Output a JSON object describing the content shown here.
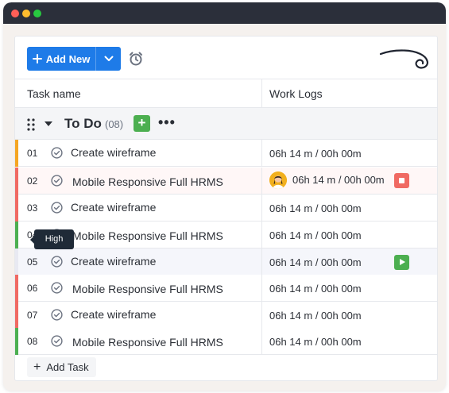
{
  "window": {
    "controls": [
      "close",
      "minimize",
      "maximize"
    ]
  },
  "toolbar": {
    "add_new_label": "Add New",
    "add_icon": "plus-icon",
    "dropdown_icon": "chevron-down-icon",
    "alarm_icon": "alarm-clock-icon",
    "logo_icon": "swirl-logo"
  },
  "table": {
    "columns": [
      "Task name",
      "Work Logs"
    ]
  },
  "group": {
    "title": "To Do",
    "count": "(08)",
    "add_label": "+",
    "more_label": "•••",
    "color": "#4caf50"
  },
  "tasks": [
    {
      "num": "01",
      "name": "Create wireframe",
      "log": "06h 14 m / 00h 00m",
      "priority_color": "#f5a623"
    },
    {
      "num": "02",
      "name": "Mobile Responsive Full HRMS",
      "log": "06h 14 m / 00h 00m",
      "priority_color": "#f06a63",
      "timer": "stop"
    },
    {
      "num": "03",
      "name": "Create wireframe",
      "log": "06h 14 m / 00h 00m",
      "priority_color": "#f06a63"
    },
    {
      "num": "04",
      "name": "Mobile Responsive Full HRMS",
      "log": "06h 14 m / 00h 00m",
      "priority_color": "#4caf50"
    },
    {
      "num": "05",
      "name": "Create wireframe",
      "log": "06h 14 m / 00h 00m",
      "priority_color": "#e8e9f2",
      "timer": "play"
    },
    {
      "num": "06",
      "name": "Mobile Responsive Full HRMS",
      "log": "06h 14 m / 00h 00m",
      "priority_color": "#f06a63"
    },
    {
      "num": "07",
      "name": "Create wireframe",
      "log": "06h 14 m / 00h 00m",
      "priority_color": "#f06a63"
    },
    {
      "num": "08",
      "name": "Mobile Responsive Full HRMS",
      "log": "06h 14 m / 00h 00m",
      "priority_color": "#4caf50"
    }
  ],
  "tooltip": {
    "text": "High"
  },
  "footer": {
    "add_task_label": "Add Task"
  },
  "colors": {
    "accent": "#1e7be8",
    "stop": "#f06a63",
    "play": "#4caf50"
  }
}
